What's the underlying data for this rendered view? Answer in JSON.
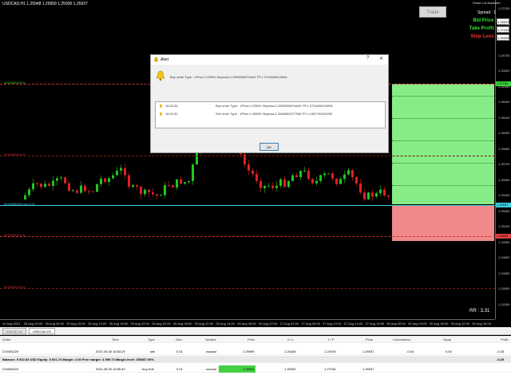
{
  "chart": {
    "title": "USDCAD,H1 1.25948 1.25959 1.25930 1.25937",
    "price_ticks": [
      "1.27200",
      "1.27050",
      "1.26900",
      "1.26750",
      "1.26600",
      "1.26450",
      "1.26300",
      "1.26150",
      "1.26000",
      "1.25850",
      "1.25700",
      "1.25550",
      "1.25400",
      "1.25250",
      "1.25100",
      "1.24950",
      "1.24800",
      "1.24650",
      "1.24500",
      "1.24350"
    ],
    "tp_tag": "1.27160",
    "current_tag": "1.25937",
    "sl_tag": "1.25334",
    "tp_line_label": "#219454229 tp",
    "entry_line_label": "#219454229 sl",
    "bid_line_label": "#219454229 buy 0.01",
    "sl_line_label": "#219454229 sl",
    "lower_line_label": "#219454229 tp",
    "time_labels": [
      "24 Aug 2021",
      "25 Aug 02:00",
      "25 Aug 06:00",
      "25 Aug 10:00",
      "25 Aug 14:00",
      "25 Aug 18:00",
      "25 Aug 22:00",
      "26 Aug 02:00",
      "26 Aug 06:00",
      "26 Aug 10:00",
      "26 Aug 14:00",
      "26 Aug 18:00",
      "26 Aug 22:00",
      "27 Aug 02:00",
      "27 Aug 06:00",
      "27 Aug 10:00",
      "27 Aug 14:00",
      "27 Aug 18:00",
      "30 Aug 00:00",
      "30 Aug 04:00",
      "30 Aug 08:00",
      "30 Aug 12:00",
      "30 Aug 16:00"
    ],
    "rr_text": "RR : 3.31"
  },
  "panel": {
    "assistant_title": "Smart Lot Assistant",
    "spread": "Spread : 1",
    "trade_button": "Trade",
    "bid_price_label": "Bid Price :",
    "bid_price_value": "1.25937",
    "take_profit_label": "Take Profit :",
    "take_profit_value": "1.27243",
    "stop_loss_label": "Stop Loss :",
    "stop_loss_value": "1.25334",
    "colors": {
      "bid": "#2ee62e",
      "tp": "#2ee62e",
      "sl": "#ff3030"
    }
  },
  "dialog": {
    "title": "Alert",
    "help": "?",
    "close": "✕",
    "message": "Buy order Type : 1Price:1.25901 Stoploss:1.2553355974843 TP:1.2724626415094",
    "rows": [
      {
        "time": "18:22:46",
        "msg": "Buy order Type : 1Price:1.25901 Stoploss:1.2553355974843 TP:1.2724626415094"
      },
      {
        "time": "18:22:30",
        "msg": "Sell order Type : 1Price:1.25899 Stoploss:1.2646660377358 TP:1.2451761194030"
      }
    ],
    "ok": "OK"
  },
  "tabs": [
    "EAUSD,H1",
    "USDCAD,H1"
  ],
  "terminal": {
    "headers": [
      "Order",
      "Time",
      "Type",
      "Size",
      "Symbol",
      "Price",
      "S / L",
      "T / P",
      "Price",
      "Commission",
      "Swap",
      "Profit"
    ],
    "rows": [
      [
        "219454229",
        "2021.08.30 16:53:29",
        "sell",
        "0.01",
        "usdcad",
        "1.25999",
        "1.26449",
        "1.24978",
        "1.25937",
        "-0.04",
        "0.00",
        "-0.25"
      ],
      [
        "219454523",
        "2021.08.30 16:55:40",
        "buy limit",
        "0.01",
        "usdcad",
        "1.25901",
        "1.25334",
        "1.27246",
        "1.25937",
        "",
        "",
        ""
      ]
    ],
    "balance": "Balance: 5 002.83 USD  Equity: 5 001.74  Margin: 2.00  Free margin: 4 999.74  Margin level: 250087.00%",
    "balance_profit": "-0.29"
  }
}
